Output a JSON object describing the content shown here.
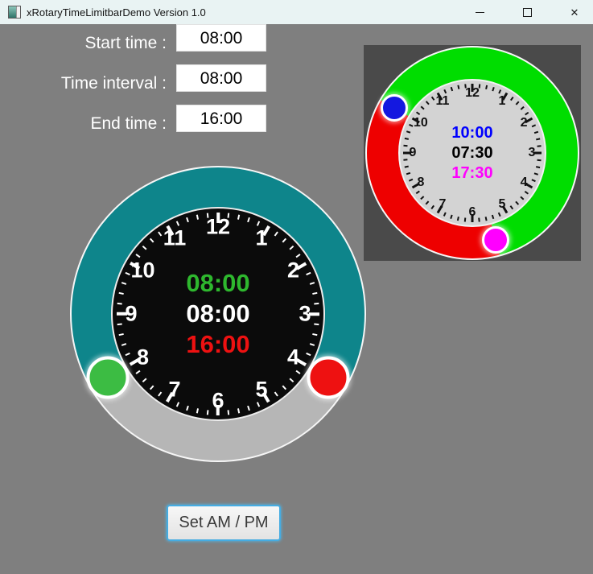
{
  "window": {
    "title": "xRotaryTimeLimitbarDemo Version 1.0",
    "controls": {
      "close_glyph": "✕"
    }
  },
  "form": {
    "fields": [
      {
        "label": "Start time :",
        "value": "08:00"
      },
      {
        "label": "Time interval :",
        "value": "08:00"
      },
      {
        "label": "End time :",
        "value": "16:00"
      }
    ]
  },
  "set_ampm_button": {
    "label": "Set AM / PM"
  },
  "large_clock": {
    "start_time": "08:00",
    "interval": "08:00",
    "end_time": "16:00",
    "numbers": [
      "1",
      "2",
      "3",
      "4",
      "5",
      "6",
      "7",
      "8",
      "9",
      "10",
      "11",
      "12"
    ],
    "start_angle_deg": 240,
    "interval_arc_deg": 240,
    "handles": {
      "start": {
        "icon": "start-handle",
        "color": "#3cbc43",
        "angle_deg": 240
      },
      "end": {
        "icon": "end-handle",
        "color": "#ee1111",
        "angle_deg": 120
      }
    },
    "colors": {
      "interval_arc": "#0e858b",
      "remainder_arc": "#b6b6b6",
      "face": "#0b0b0b",
      "ticks": "#ffffff",
      "numbers": "#ffffff",
      "start_text": "#2eb82e",
      "interval_text": "#ffffff",
      "end_text": "#ee1111"
    }
  },
  "small_clock": {
    "start_time": "10:00",
    "interval": "07:30",
    "end_time": "17:30",
    "numbers": [
      "1",
      "2",
      "3",
      "4",
      "5",
      "6",
      "7",
      "8",
      "9",
      "10",
      "11",
      "12"
    ],
    "start_angle_deg": 300,
    "interval_arc_deg": 225,
    "handles": {
      "start": {
        "icon": "start-handle",
        "color": "#1418e0",
        "angle_deg": 300
      },
      "end": {
        "icon": "end-handle",
        "color": "#ff00ff",
        "angle_deg": 165
      }
    },
    "colors": {
      "interval_arc": "#00dd00",
      "remainder_arc": "#ee0000",
      "face": "#d3d3d3",
      "ticks": "#111111",
      "numbers": "#111111",
      "start_text": "#0000ff",
      "interval_text": "#000000",
      "end_text": "#ff00ff"
    }
  }
}
